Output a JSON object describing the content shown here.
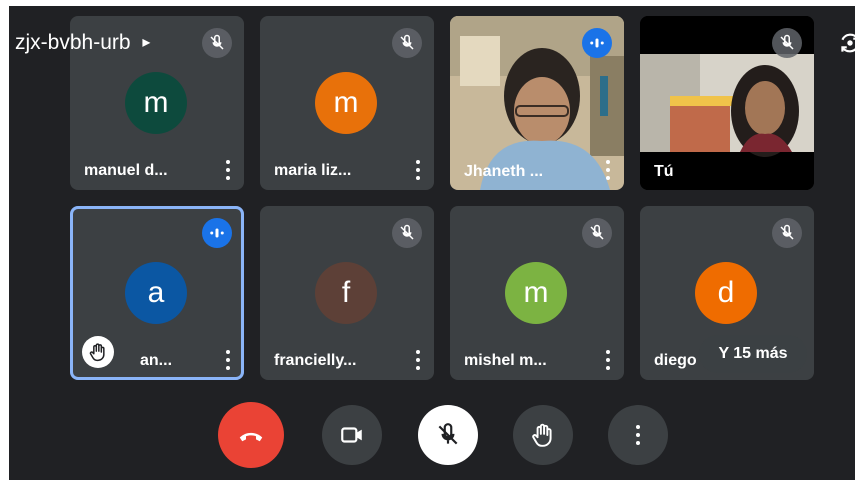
{
  "meeting": {
    "code": "zjx-bvbh-urb",
    "arrow": "▸"
  },
  "tiles": [
    {
      "name": "manuel d...",
      "initial": "m",
      "avatar_color": "#0d4a3d",
      "muted": true
    },
    {
      "name": "maria liz...",
      "initial": "m",
      "avatar_color": "#e8710a",
      "muted": true
    },
    {
      "name": "Jhaneth ...",
      "video": true,
      "speaking": true
    },
    {
      "name": "Tú",
      "video": true,
      "muted": true
    },
    {
      "name": "an...",
      "initial": "a",
      "avatar_color": "#0b57a3",
      "speaking": true,
      "hand_raised": true
    },
    {
      "name": "francielly...",
      "initial": "f",
      "avatar_color": "#5d4037",
      "muted": true
    },
    {
      "name": "mishel m...",
      "initial": "m",
      "avatar_color": "#7cb342",
      "muted": true
    },
    {
      "name": "diego",
      "initial": "d",
      "avatar_color": "#ef6c00",
      "muted": true
    }
  ],
  "overflow": {
    "label": "Y 15 más"
  },
  "controls": {
    "end_call_color": "#ea4335",
    "button_color": "#3c4043",
    "mic_button_color": "#ffffff"
  },
  "icons": [
    "mic-off-icon",
    "speaking-icon",
    "raise-hand-icon",
    "more-vert-icon",
    "end-call-icon",
    "camera-icon",
    "switch-camera-icon"
  ]
}
